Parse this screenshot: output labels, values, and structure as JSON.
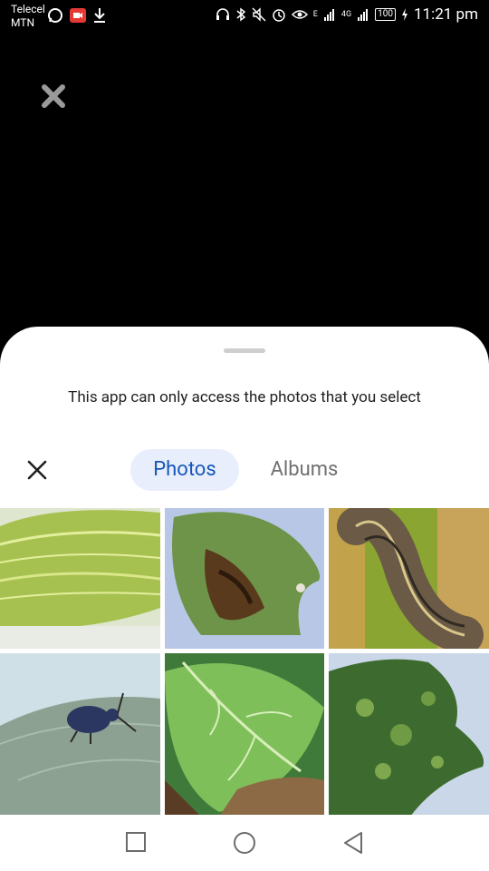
{
  "status_bar": {
    "carrier_line1": "Telecel",
    "carrier_line2": "MTN",
    "battery": "100",
    "time": "11:21 pm",
    "network_1": "E",
    "network_2": "4G"
  },
  "sheet": {
    "notice": "This app can only access the photos that you select",
    "tabs": [
      {
        "label": "Photos",
        "selected": true
      },
      {
        "label": "Albums",
        "selected": false
      }
    ]
  },
  "photos": [
    {
      "name": "striped leaf"
    },
    {
      "name": "diseased leaf"
    },
    {
      "name": "caterpillar"
    },
    {
      "name": "weevil on leaf"
    },
    {
      "name": "green leaf with brown edge"
    },
    {
      "name": "mottled leaf"
    }
  ],
  "colors": {
    "accent": "#1656b8",
    "selected_tab_bg": "#e8eefc"
  }
}
